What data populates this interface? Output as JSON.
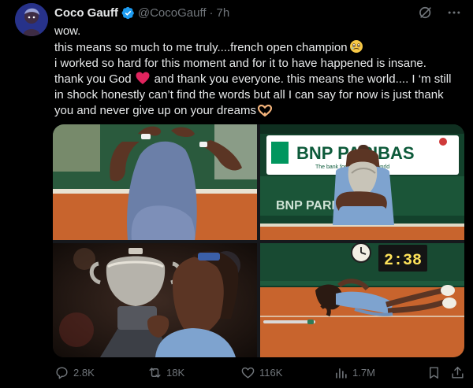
{
  "author": {
    "name": "Coco Gauff",
    "handle": "@CocoGauff",
    "separator": "·",
    "time": "7h"
  },
  "post": {
    "lines": [
      "wow.",
      "this means so much to me truly....french open champion",
      "i worked so hard for this moment and for it to have happened is insane.",
      "thank you God",
      "and thank you everyone. this means the world.... I ‘m still",
      "in shock honestly can’t find the words but all I can say for now is just thank",
      "you and never give up on your dreams"
    ],
    "emojis": [
      "face-holding-back-tears",
      "red-heart",
      "heart-hands"
    ]
  },
  "media": {
    "photo2_banner_text": "BNP PARIBAS",
    "photo2_banner_small": "The bank for a changing world",
    "photo2_board_text": "BNP PARIBAS",
    "photo4_clock": "2:38"
  },
  "actions": {
    "replies": "2.8K",
    "reposts": "18K",
    "likes": "116K",
    "views": "1.7M"
  },
  "colors": {
    "background": "#000000",
    "text": "#e7e9ea",
    "muted": "#71767b",
    "verified": "#1d9bf0",
    "clay": "#c8642d"
  }
}
